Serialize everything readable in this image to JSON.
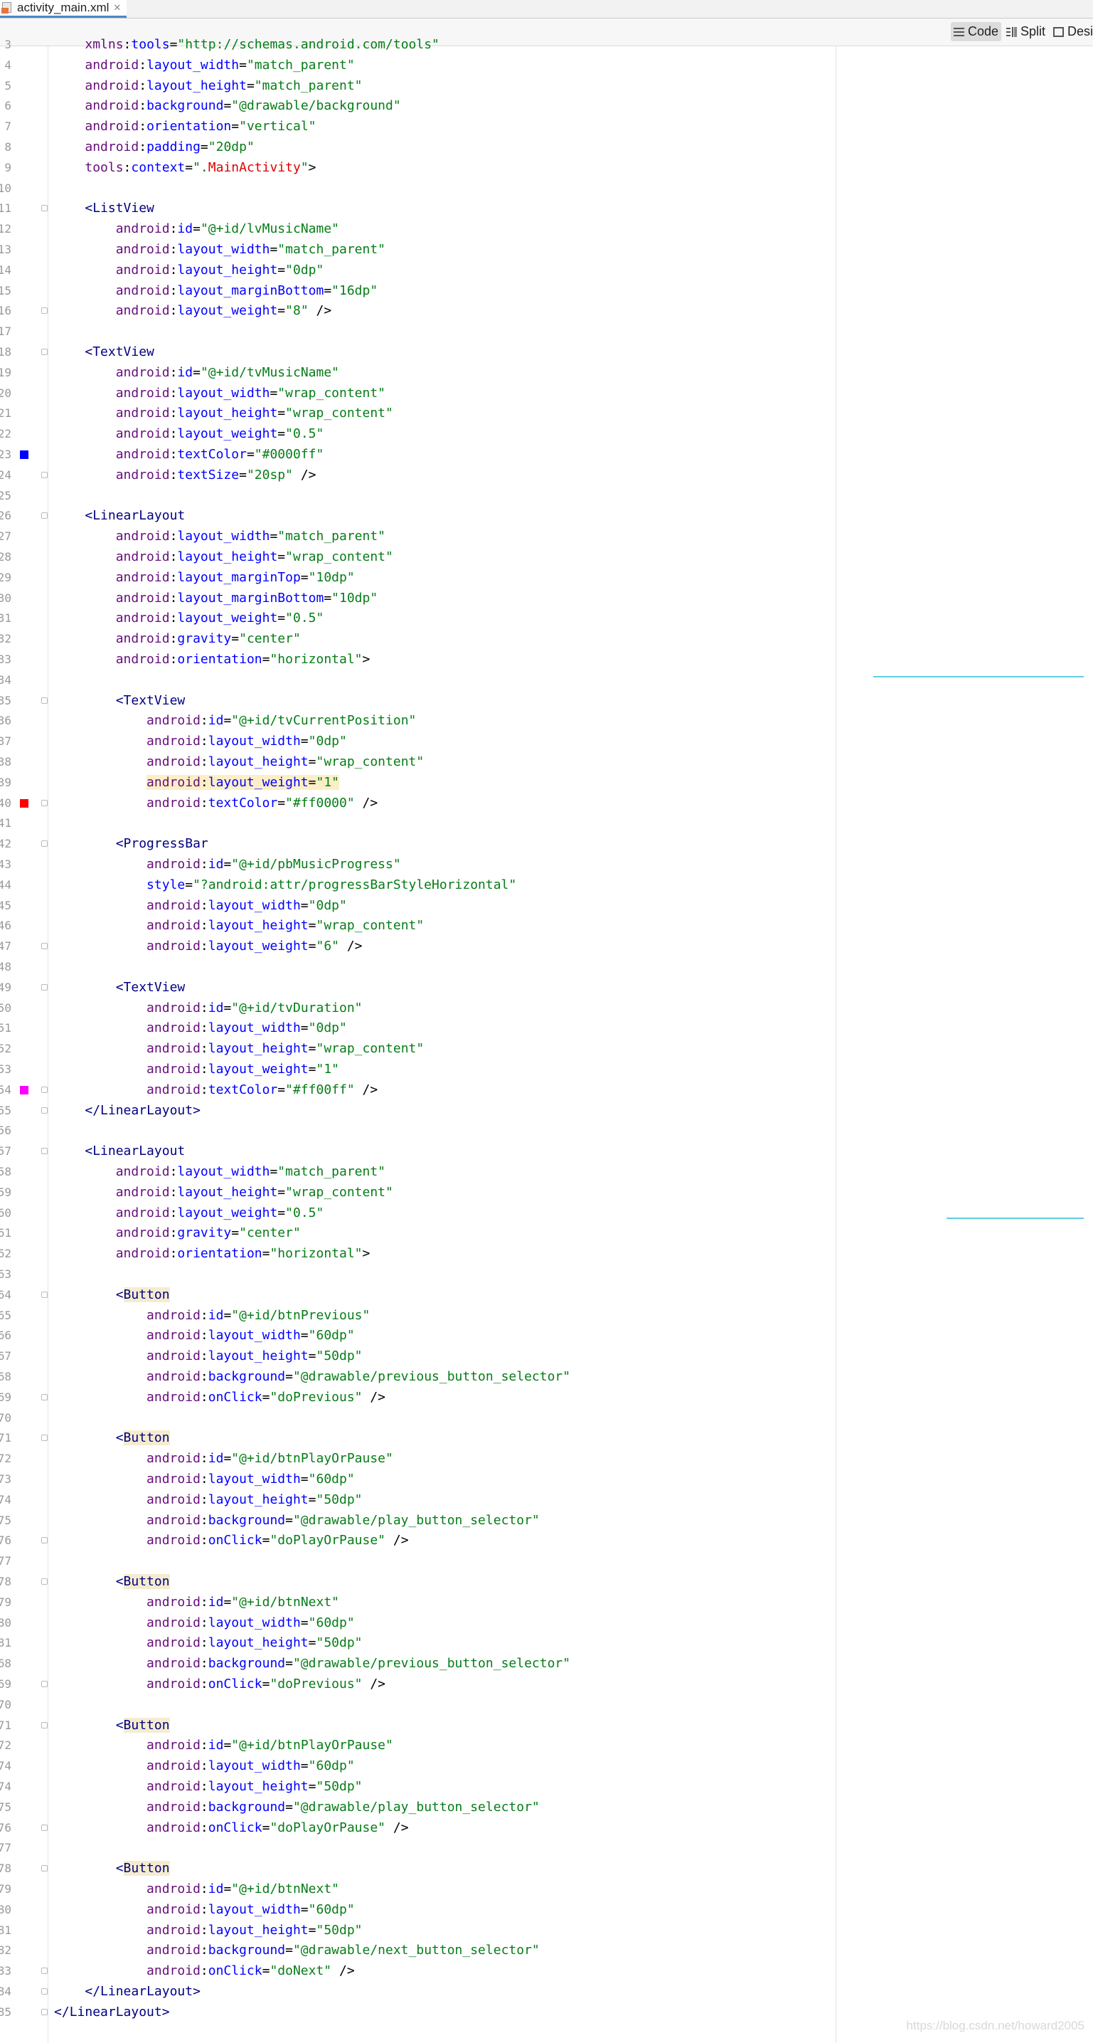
{
  "tab": {
    "filename": "activity_main.xml",
    "close": "✕"
  },
  "toolbar": {
    "code": "Code",
    "split": "Split",
    "design": "Design"
  },
  "watermark": "https://blog.csdn.net/howard2005",
  "colors": {
    "blue_marker": "#0000ff",
    "red_marker": "#ff0000",
    "magenta_marker": "#ff00ff"
  },
  "lines": [
    {
      "n": "3",
      "t": "    xmlns:tools=\"http://schemas.android.com/tools\""
    },
    {
      "n": "4",
      "t": "    android:layout_width=\"match_parent\""
    },
    {
      "n": "5",
      "t": "    android:layout_height=\"match_parent\""
    },
    {
      "n": "6",
      "t": "    android:background=\"@drawable/background\""
    },
    {
      "n": "7",
      "t": "    android:orientation=\"vertical\""
    },
    {
      "n": "8",
      "t": "    android:padding=\"20dp\""
    },
    {
      "n": "9",
      "t": "    tools:context=\".MainActivity\">"
    },
    {
      "n": "10",
      "t": ""
    },
    {
      "n": "11",
      "t": "    <ListView",
      "fold": true
    },
    {
      "n": "12",
      "t": "        android:id=\"@+id/lvMusicName\""
    },
    {
      "n": "13",
      "t": "        android:layout_width=\"match_parent\""
    },
    {
      "n": "14",
      "t": "        android:layout_height=\"0dp\""
    },
    {
      "n": "15",
      "t": "        android:layout_marginBottom=\"16dp\""
    },
    {
      "n": "16",
      "t": "        android:layout_weight=\"8\" />",
      "fold": true
    },
    {
      "n": "17",
      "t": ""
    },
    {
      "n": "18",
      "t": "    <TextView",
      "fold": true
    },
    {
      "n": "19",
      "t": "        android:id=\"@+id/tvMusicName\""
    },
    {
      "n": "20",
      "t": "        android:layout_width=\"wrap_content\""
    },
    {
      "n": "21",
      "t": "        android:layout_height=\"wrap_content\""
    },
    {
      "n": "22",
      "t": "        android:layout_weight=\"0.5\""
    },
    {
      "n": "23",
      "t": "        android:textColor=\"#0000ff\"",
      "mark": "blue_marker"
    },
    {
      "n": "24",
      "t": "        android:textSize=\"20sp\" />",
      "fold": true
    },
    {
      "n": "25",
      "t": ""
    },
    {
      "n": "26",
      "t": "    <LinearLayout",
      "fold": true
    },
    {
      "n": "27",
      "t": "        android:layout_width=\"match_parent\""
    },
    {
      "n": "28",
      "t": "        android:layout_height=\"wrap_content\""
    },
    {
      "n": "29",
      "t": "        android:layout_marginTop=\"10dp\""
    },
    {
      "n": "30",
      "t": "        android:layout_marginBottom=\"10dp\""
    },
    {
      "n": "31",
      "t": "        android:layout_weight=\"0.5\""
    },
    {
      "n": "32",
      "t": "        android:gravity=\"center\""
    },
    {
      "n": "33",
      "t": "        android:orientation=\"horizontal\">"
    },
    {
      "n": "34",
      "t": ""
    },
    {
      "n": "35",
      "t": "        <TextView",
      "fold": true
    },
    {
      "n": "36",
      "t": "            android:id=\"@+id/tvCurrentPosition\""
    },
    {
      "n": "37",
      "t": "            android:layout_width=\"0dp\""
    },
    {
      "n": "38",
      "t": "            android:layout_height=\"wrap_content\""
    },
    {
      "n": "39",
      "t": "            android:layout_weight=\"1\"",
      "hl": true
    },
    {
      "n": "40",
      "t": "            android:textColor=\"#ff0000\" />",
      "mark": "red_marker",
      "fold": true
    },
    {
      "n": "41",
      "t": ""
    },
    {
      "n": "42",
      "t": "        <ProgressBar",
      "fold": true
    },
    {
      "n": "43",
      "t": "            android:id=\"@+id/pbMusicProgress\""
    },
    {
      "n": "44",
      "t": "            style=\"?android:attr/progressBarStyleHorizontal\""
    },
    {
      "n": "45",
      "t": "            android:layout_width=\"0dp\""
    },
    {
      "n": "46",
      "t": "            android:layout_height=\"wrap_content\""
    },
    {
      "n": "47",
      "t": "            android:layout_weight=\"6\" />",
      "fold": true
    },
    {
      "n": "48",
      "t": ""
    },
    {
      "n": "49",
      "t": "        <TextView",
      "fold": true
    },
    {
      "n": "50",
      "t": "            android:id=\"@+id/tvDuration\""
    },
    {
      "n": "51",
      "t": "            android:layout_width=\"0dp\""
    },
    {
      "n": "52",
      "t": "            android:layout_height=\"wrap_content\""
    },
    {
      "n": "53",
      "t": "            android:layout_weight=\"1\""
    },
    {
      "n": "54",
      "t": "            android:textColor=\"#ff00ff\" />",
      "mark": "magenta_marker",
      "fold": true
    },
    {
      "n": "55",
      "t": "    </LinearLayout>",
      "fold": true
    },
    {
      "n": "56",
      "t": ""
    },
    {
      "n": "57",
      "t": "    <LinearLayout",
      "fold": true
    },
    {
      "n": "58",
      "t": "        android:layout_width=\"match_parent\""
    },
    {
      "n": "59",
      "t": "        android:layout_height=\"wrap_content\""
    },
    {
      "n": "60",
      "t": "        android:layout_weight=\"0.5\""
    },
    {
      "n": "61",
      "t": "        android:gravity=\"center\""
    },
    {
      "n": "62",
      "t": "        android:orientation=\"horizontal\">"
    },
    {
      "n": "63",
      "t": ""
    },
    {
      "n": "64",
      "t": "        <Button",
      "fold": true
    },
    {
      "n": "65",
      "t": "            android:id=\"@+id/btnPrevious\""
    },
    {
      "n": "66",
      "t": "            android:layout_width=\"60dp\""
    },
    {
      "n": "67",
      "t": "            android:layout_height=\"50dp\""
    },
    {
      "n": "68",
      "t": "            android:background=\"@drawable/previous_button_selector\""
    },
    {
      "n": "69",
      "t": "            android:onClick=\"doPrevious\" />",
      "fold": true
    },
    {
      "n": "70",
      "t": ""
    },
    {
      "n": "71",
      "t": "        <Button",
      "fold": true
    },
    {
      "n": "72",
      "t": "            android:id=\"@+id/btnPlayOrPause\""
    },
    {
      "n": "73",
      "t": "            android:layout_width=\"60dp\""
    },
    {
      "n": "74",
      "t": "            android:layout_height=\"50dp\""
    },
    {
      "n": "75",
      "t": "            android:background=\"@drawable/play_button_selector\""
    },
    {
      "n": "76",
      "t": "            android:onClick=\"doPlayOrPause\" />",
      "fold": true
    },
    {
      "n": "77",
      "t": ""
    },
    {
      "n": "78",
      "t": "        <Button",
      "fold": true
    },
    {
      "n": "79",
      "t": "            android:id=\"@+id/btnNext\""
    },
    {
      "n": "80",
      "t": "            android:layout_width=\"60dp\""
    },
    {
      "n": "81",
      "t": "            android:layout_height=\"50dp\""
    },
    {
      "n": "68",
      "t": "            android:background=\"@drawable/previous_button_selector\""
    },
    {
      "n": "69",
      "t": "            android:onClick=\"doPrevious\" />",
      "fold": true
    },
    {
      "n": "70",
      "t": ""
    },
    {
      "n": "71",
      "t": "        <Button",
      "fold": true
    },
    {
      "n": "72",
      "t": "            android:id=\"@+id/btnPlayOrPause\""
    },
    {
      "n": "74",
      "t": "            android:layout_width=\"60dp\""
    },
    {
      "n": "74",
      "t": "            android:layout_height=\"50dp\""
    },
    {
      "n": "75",
      "t": "            android:background=\"@drawable/play_button_selector\""
    },
    {
      "n": "76",
      "t": "            android:onClick=\"doPlayOrPause\" />",
      "fold": true
    },
    {
      "n": "77",
      "t": ""
    },
    {
      "n": "78",
      "t": "        <Button",
      "fold": true
    },
    {
      "n": "79",
      "t": "            android:id=\"@+id/btnNext\""
    },
    {
      "n": "80",
      "t": "            android:layout_width=\"60dp\""
    },
    {
      "n": "81",
      "t": "            android:layout_height=\"50dp\""
    },
    {
      "n": "82",
      "t": "            android:background=\"@drawable/next_button_selector\""
    },
    {
      "n": "83",
      "t": "            android:onClick=\"doNext\" />",
      "fold": true
    },
    {
      "n": "84",
      "t": "    </LinearLayout>",
      "fold": true
    },
    {
      "n": "85",
      "t": "</LinearLayout>",
      "fold": true
    }
  ]
}
